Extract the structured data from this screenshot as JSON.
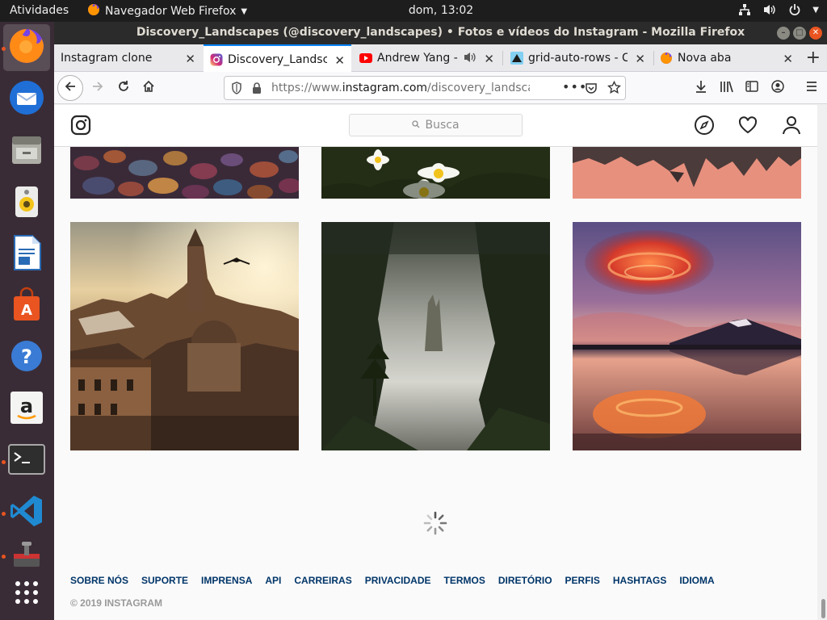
{
  "topbar": {
    "activities": "Atividades",
    "app_name": "Navegador Web Firefox",
    "clock": "dom, 13:02"
  },
  "dock": {
    "items": [
      {
        "name": "firefox",
        "active": true,
        "running": true
      },
      {
        "name": "thunderbird",
        "active": false,
        "running": false
      },
      {
        "name": "files",
        "active": false,
        "running": false
      },
      {
        "name": "rhythmbox",
        "active": false,
        "running": false
      },
      {
        "name": "libreoffice-writer",
        "active": false,
        "running": false
      },
      {
        "name": "ubuntu-software",
        "active": false,
        "running": false
      },
      {
        "name": "help",
        "active": false,
        "running": false
      },
      {
        "name": "amazon",
        "active": false,
        "running": false
      },
      {
        "name": "terminal",
        "active": false,
        "running": true
      },
      {
        "name": "vscode",
        "active": false,
        "running": true
      },
      {
        "name": "joystick",
        "active": false,
        "running": true
      },
      {
        "name": "show-applications",
        "active": false,
        "running": false
      }
    ]
  },
  "window": {
    "title": "Discovery_Landscapes (@discovery_landscapes) • Fotos e vídeos do Instagram - Mozilla Firefox"
  },
  "tabs": [
    {
      "title": "Instagram clone",
      "active": false
    },
    {
      "title": "Discovery_Landscapes",
      "active": true
    },
    {
      "title": "Andrew Yang - H",
      "active": false
    },
    {
      "title": "grid-auto-rows - CSS",
      "active": false
    },
    {
      "title": "Nova aba",
      "active": false
    }
  ],
  "urlbar": {
    "prefix": "https://www.",
    "domain": "instagram.com",
    "path": "/discovery_landscapes/"
  },
  "instagram": {
    "search_placeholder": "Busca",
    "footer_links": [
      "SOBRE NÓS",
      "SUPORTE",
      "IMPRENSA",
      "API",
      "CARREIRAS",
      "PRIVACIDADE",
      "TERMOS",
      "DIRETÓRIO",
      "PERFIS",
      "HASHTAGS",
      "IDIOMA"
    ],
    "copyright": "© 2019 INSTAGRAM"
  },
  "colors": {
    "ubuntu_orange": "#e95420",
    "firefox_accent": "#0a84ff",
    "ig_link": "#003569"
  }
}
